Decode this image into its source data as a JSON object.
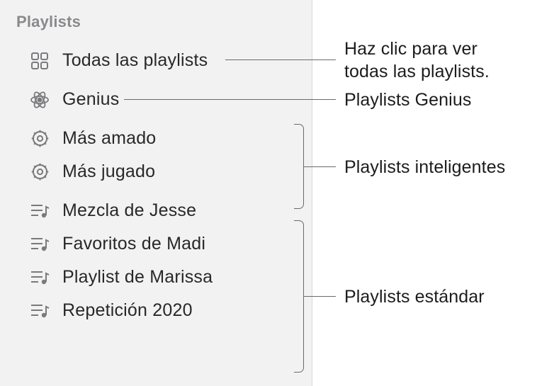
{
  "sidebar": {
    "header": "Playlists",
    "items": {
      "all": {
        "label": "Todas las playlists"
      },
      "genius": {
        "label": "Genius"
      },
      "smart_loved": {
        "label": "Más amado"
      },
      "smart_played": {
        "label": "Más jugado"
      },
      "std_jesse": {
        "label": "Mezcla de Jesse"
      },
      "std_madi": {
        "label": "Favoritos de Madi"
      },
      "std_marissa": {
        "label": "Playlist de Marissa"
      },
      "std_2020": {
        "label": "Repetición 2020"
      }
    }
  },
  "callouts": {
    "all_line1": "Haz clic para ver",
    "all_line2": "todas las playlists.",
    "genius": "Playlists Genius",
    "smart": "Playlists inteligentes",
    "standard": "Playlists estándar"
  }
}
